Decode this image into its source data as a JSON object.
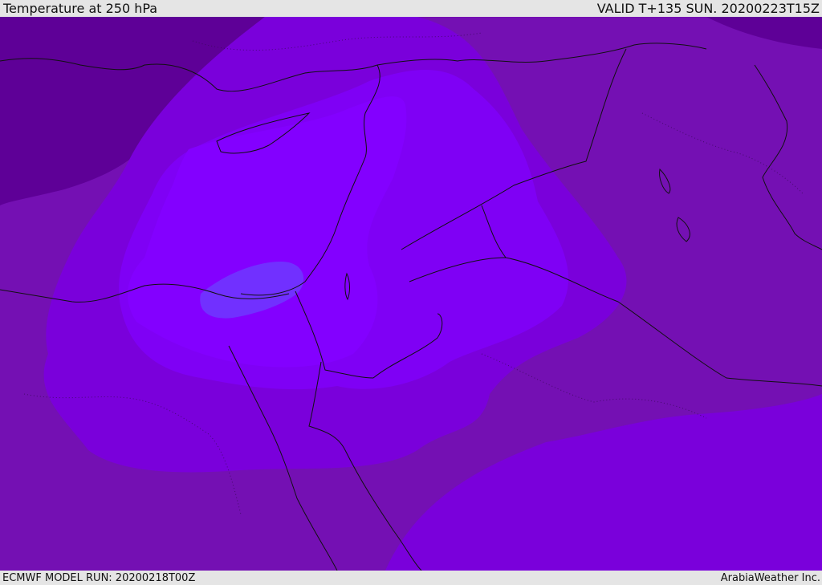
{
  "header": {
    "title": "Temperature at 250 hPa",
    "valid_time": "VALID T+135 SUN. 20200223T15Z"
  },
  "footer": {
    "model_run": "ECMWF MODEL RUN: 20200218T00Z",
    "credit": "ArabiaWeather Inc."
  },
  "palette": {
    "deepest": "#5e0097",
    "outer": "#7410b3",
    "mid": "#7a00db",
    "inner": "#7f00f5",
    "core": "#8300ff",
    "warmest": "#7130ff",
    "coast": "#111111"
  }
}
